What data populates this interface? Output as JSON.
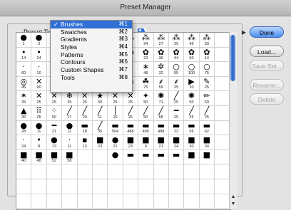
{
  "window": {
    "title": "Preset Manager"
  },
  "preset_type": {
    "label": "Preset Type:"
  },
  "menu": {
    "items": [
      {
        "label": "Brushes",
        "shortcut": "⌘1",
        "checked": true
      },
      {
        "label": "Swatches",
        "shortcut": "⌘2"
      },
      {
        "label": "Gradients",
        "shortcut": "⌘3"
      },
      {
        "label": "Styles",
        "shortcut": "⌘4"
      },
      {
        "label": "Patterns",
        "shortcut": "⌘5"
      },
      {
        "label": "Contours",
        "shortcut": "⌘6"
      },
      {
        "label": "Custom Shapes",
        "shortcut": "⌘7"
      },
      {
        "label": "Tools",
        "shortcut": "⌘8"
      }
    ],
    "check_glyph": "✓"
  },
  "buttons": {
    "done": "Done",
    "load": "Load...",
    "save": "Save Set...",
    "rename": "Rename...",
    "delete": "Delete"
  },
  "flyout_glyph": "▶",
  "popup_glyph": "▲▼",
  "brushes": [
    {
      "g": "●",
      "n": "1"
    },
    {
      "g": "●",
      "n": "3"
    },
    {
      "g": "",
      "n": ""
    },
    {
      "g": "",
      "n": ""
    },
    {
      "g": "",
      "n": ""
    },
    {
      "g": "",
      "n": ""
    },
    {
      "g": "",
      "n": ""
    },
    {
      "g": "⁂",
      "n": "14"
    },
    {
      "g": "⁂",
      "n": "24"
    },
    {
      "g": "⁂",
      "n": "27"
    },
    {
      "g": "⁂",
      "n": "39"
    },
    {
      "g": "⁂",
      "n": "46"
    },
    {
      "g": "⁂",
      "n": "59"
    },
    {
      "g": "",
      "n": ""
    },
    {
      "g": "•",
      "n": "14"
    },
    {
      "g": "•",
      "n": "24"
    },
    {
      "g": "",
      "n": ""
    },
    {
      "g": "",
      "n": ""
    },
    {
      "g": "",
      "n": ""
    },
    {
      "g": "",
      "n": ""
    },
    {
      "g": "",
      "n": ""
    },
    {
      "g": "▬",
      "n": "17"
    },
    {
      "g": "✿",
      "n": "23"
    },
    {
      "g": "✿",
      "n": "36"
    },
    {
      "g": "✿",
      "n": "44"
    },
    {
      "g": "✿",
      "n": "60"
    },
    {
      "g": "✿",
      "n": "14"
    },
    {
      "g": "",
      "n": ""
    },
    {
      "g": "·",
      "n": "60"
    },
    {
      "g": "·",
      "n": "10"
    },
    {
      "g": "",
      "n": ""
    },
    {
      "g": "",
      "n": ""
    },
    {
      "g": "",
      "n": ""
    },
    {
      "g": "",
      "n": ""
    },
    {
      "g": "",
      "n": ""
    },
    {
      "g": "",
      "n": "75"
    },
    {
      "g": "∗",
      "n": "48"
    },
    {
      "g": "✲",
      "n": "32"
    },
    {
      "g": "○",
      "n": "55"
    },
    {
      "g": "○",
      "n": "100"
    },
    {
      "g": "○",
      "n": "75"
    },
    {
      "g": "",
      "n": ""
    },
    {
      "g": "◎",
      "n": "45"
    },
    {
      "g": "✕",
      "n": "90"
    },
    {
      "g": "✗",
      "n": "21"
    },
    {
      "g": "❋",
      "n": "60"
    },
    {
      "g": "✕",
      "n": "14"
    },
    {
      "g": "○",
      "n": "43"
    },
    {
      "g": "○",
      "n": "23"
    },
    {
      "g": "◎",
      "n": "58"
    },
    {
      "g": "☘",
      "n": "75"
    },
    {
      "g": "⸙",
      "n": "59"
    },
    {
      "g": "⸙",
      "n": "25"
    },
    {
      "g": "▶",
      "n": "20"
    },
    {
      "g": "✎",
      "n": "25"
    },
    {
      "g": "",
      "n": ""
    },
    {
      "g": "✶",
      "n": "25"
    },
    {
      "g": "✕",
      "n": "25"
    },
    {
      "g": "✕",
      "n": "25"
    },
    {
      "g": "❄",
      "n": "25"
    },
    {
      "g": "✕",
      "n": "25"
    },
    {
      "g": "★",
      "n": "50"
    },
    {
      "g": "✕",
      "n": "25"
    },
    {
      "g": "✕",
      "n": "25"
    },
    {
      "g": "✦",
      "n": "50"
    },
    {
      "g": "✺",
      "n": "71"
    },
    {
      "g": "╱",
      "n": "25"
    },
    {
      "g": "✺",
      "n": "50"
    },
    {
      "g": "✏",
      "n": "50"
    },
    {
      "g": "",
      "n": ""
    },
    {
      "g": "▲",
      "n": "36"
    },
    {
      "g": "⠿",
      "n": "25"
    },
    {
      "g": "⁘",
      "n": "50"
    },
    {
      "g": "╱",
      "n": "17"
    },
    {
      "g": "╱",
      "n": "20"
    },
    {
      "g": "╱",
      "n": "11"
    },
    {
      "g": "│",
      "n": "10"
    },
    {
      "g": "╱",
      "n": "25"
    },
    {
      "g": "╱",
      "n": "50"
    },
    {
      "g": "╱",
      "n": "58"
    },
    {
      "g": "━",
      "n": "25"
    },
    {
      "g": "╱",
      "n": "25"
    },
    {
      "g": "╱",
      "n": "25"
    },
    {
      "g": "",
      "n": ""
    },
    {
      "g": "●",
      "n": "28"
    },
    {
      "g": "●",
      "n": "11"
    },
    {
      "g": "━",
      "n": "21"
    },
    {
      "g": "●",
      "n": "11"
    },
    {
      "g": "▬",
      "n": "18"
    },
    {
      "g": "╱",
      "n": "35"
    },
    {
      "g": "▬",
      "n": "504"
    },
    {
      "g": "▬",
      "n": "488"
    },
    {
      "g": "▬",
      "n": "495"
    },
    {
      "g": "▬",
      "n": "488"
    },
    {
      "g": "▬",
      "n": "22"
    },
    {
      "g": "▬",
      "n": "56"
    },
    {
      "g": "▬",
      "n": "62"
    },
    {
      "g": "",
      "n": ""
    },
    {
      "g": "·",
      "n": "24"
    },
    {
      "g": "•",
      "n": "8"
    },
    {
      "g": "●",
      "n": "13"
    },
    {
      "g": "·",
      "n": "11"
    },
    {
      "g": "▪",
      "n": "13"
    },
    {
      "g": "■",
      "n": "23"
    },
    {
      "g": "●",
      "n": "21"
    },
    {
      "g": "■",
      "n": "23"
    },
    {
      "g": "■",
      "n": "9"
    },
    {
      "g": "■",
      "n": "21"
    },
    {
      "g": "■",
      "n": "24"
    },
    {
      "g": "■",
      "n": "30"
    },
    {
      "g": "■",
      "n": "24"
    },
    {
      "g": "",
      "n": ""
    },
    {
      "g": "■",
      "n": "40"
    },
    {
      "g": "■",
      "n": "48"
    },
    {
      "g": "■",
      "n": "52"
    },
    {
      "g": "■",
      "n": "58"
    },
    {
      "g": "",
      "n": ""
    },
    {
      "g": "",
      "n": ""
    },
    {
      "g": "●",
      "n": ""
    },
    {
      "g": "▬",
      "n": ""
    },
    {
      "g": "▬",
      "n": ""
    },
    {
      "g": "▬",
      "n": ""
    },
    {
      "g": "▬",
      "n": ""
    },
    {
      "g": "■",
      "n": ""
    },
    {
      "g": "■",
      "n": ""
    },
    {
      "g": "",
      "n": ""
    },
    {
      "g": "",
      "n": ""
    },
    {
      "g": "",
      "n": ""
    },
    {
      "g": "",
      "n": ""
    },
    {
      "g": "",
      "n": ""
    },
    {
      "g": "",
      "n": ""
    },
    {
      "g": "",
      "n": ""
    },
    {
      "g": "",
      "n": ""
    },
    {
      "g": "",
      "n": ""
    },
    {
      "g": "",
      "n": ""
    },
    {
      "g": "",
      "n": ""
    },
    {
      "g": "",
      "n": ""
    },
    {
      "g": "",
      "n": ""
    },
    {
      "g": "",
      "n": ""
    },
    {
      "g": "",
      "n": ""
    },
    {
      "g": "",
      "n": ""
    },
    {
      "g": "",
      "n": ""
    },
    {
      "g": "",
      "n": ""
    },
    {
      "g": "",
      "n": ""
    },
    {
      "g": "",
      "n": ""
    },
    {
      "g": "",
      "n": ""
    },
    {
      "g": "",
      "n": ""
    },
    {
      "g": "",
      "n": ""
    },
    {
      "g": "",
      "n": ""
    },
    {
      "g": "",
      "n": ""
    },
    {
      "g": "",
      "n": ""
    },
    {
      "g": "",
      "n": ""
    },
    {
      "g": "",
      "n": ""
    },
    {
      "g": "",
      "n": ""
    },
    {
      "g": "",
      "n": ""
    },
    {
      "g": "",
      "n": ""
    },
    {
      "g": "",
      "n": ""
    },
    {
      "g": "",
      "n": ""
    },
    {
      "g": "",
      "n": ""
    },
    {
      "g": "",
      "n": ""
    },
    {
      "g": "",
      "n": ""
    },
    {
      "g": "",
      "n": ""
    },
    {
      "g": "",
      "n": ""
    },
    {
      "g": "",
      "n": ""
    },
    {
      "g": "",
      "n": ""
    },
    {
      "g": "",
      "n": ""
    },
    {
      "g": "",
      "n": ""
    },
    {
      "g": "",
      "n": ""
    }
  ],
  "scroll": {
    "up": "▲",
    "down": "▼"
  },
  "colors": {
    "accent": "#2f6fd6",
    "default_button": "#4b8ef0"
  }
}
